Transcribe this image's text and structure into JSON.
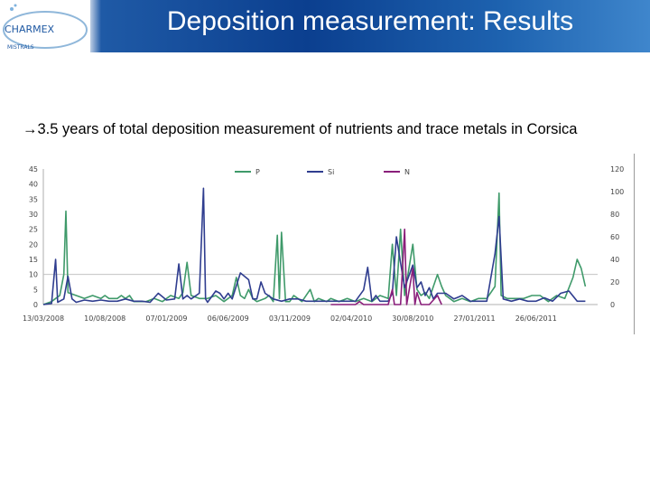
{
  "header": {
    "title": "Deposition measurement: Results",
    "logo_text": "CHARMEX",
    "logo_subtext": "MISTRALS"
  },
  "subtitle": {
    "arrow": "→",
    "text": "3.5 years of total deposition measurement of nutrients and trace metals in Corsica"
  },
  "colors": {
    "P": "#3f9a6a",
    "Si": "#2f3d8f",
    "N": "#8a1f7a",
    "header_blue": "#0b3f8f"
  },
  "chart_data": {
    "type": "line",
    "left_axis": {
      "ylim": [
        0,
        45
      ],
      "ticks": [
        "0",
        "5",
        "10",
        "15",
        "20",
        "25",
        "30",
        "35",
        "40",
        "45"
      ]
    },
    "right_axis": {
      "ylim": [
        0,
        120
      ],
      "ticks": [
        "0",
        "20",
        "40",
        "60",
        "80",
        "100",
        "120"
      ]
    },
    "x_ticks": [
      "13/03/2008",
      "10/08/2008",
      "07/01/2009",
      "06/06/2009",
      "03/11/2009",
      "02/04/2010",
      "30/08/2010",
      "27/01/2011",
      "26/06/2011"
    ],
    "x_range_days": [
      0,
      1350
    ],
    "series": [
      {
        "name": "P",
        "axis": "left",
        "points": [
          [
            0,
            0
          ],
          [
            20,
            1
          ],
          [
            30,
            2
          ],
          [
            40,
            3
          ],
          [
            50,
            10
          ],
          [
            55,
            31
          ],
          [
            60,
            4
          ],
          [
            80,
            3
          ],
          [
            100,
            2
          ],
          [
            120,
            3
          ],
          [
            140,
            2
          ],
          [
            150,
            3
          ],
          [
            160,
            2
          ],
          [
            180,
            2
          ],
          [
            190,
            3
          ],
          [
            200,
            2
          ],
          [
            210,
            3
          ],
          [
            220,
            1
          ],
          [
            250,
            1
          ],
          [
            270,
            2
          ],
          [
            290,
            1
          ],
          [
            310,
            3
          ],
          [
            330,
            2
          ],
          [
            340,
            4
          ],
          [
            350,
            14
          ],
          [
            360,
            3
          ],
          [
            380,
            2
          ],
          [
            400,
            2
          ],
          [
            420,
            3
          ],
          [
            440,
            1
          ],
          [
            450,
            2
          ],
          [
            460,
            3
          ],
          [
            470,
            9
          ],
          [
            480,
            3
          ],
          [
            490,
            2
          ],
          [
            500,
            5
          ],
          [
            510,
            2
          ],
          [
            520,
            1
          ],
          [
            540,
            2
          ],
          [
            550,
            3
          ],
          [
            560,
            1
          ],
          [
            570,
            23
          ],
          [
            575,
            2
          ],
          [
            580,
            24
          ],
          [
            590,
            1
          ],
          [
            600,
            1
          ],
          [
            610,
            3
          ],
          [
            620,
            2
          ],
          [
            630,
            1
          ],
          [
            650,
            5
          ],
          [
            660,
            1
          ],
          [
            670,
            2
          ],
          [
            690,
            1
          ],
          [
            700,
            2
          ],
          [
            720,
            1
          ],
          [
            740,
            2
          ],
          [
            760,
            1
          ],
          [
            780,
            2
          ],
          [
            800,
            1
          ],
          [
            820,
            3
          ],
          [
            840,
            2
          ],
          [
            850,
            20
          ],
          [
            860,
            3
          ],
          [
            870,
            25
          ],
          [
            880,
            3
          ],
          [
            900,
            20
          ],
          [
            910,
            5
          ],
          [
            920,
            3
          ],
          [
            930,
            4
          ],
          [
            940,
            2
          ],
          [
            960,
            10
          ],
          [
            970,
            6
          ],
          [
            980,
            3
          ],
          [
            990,
            2
          ],
          [
            1000,
            1
          ],
          [
            1020,
            2
          ],
          [
            1040,
            1
          ],
          [
            1060,
            2
          ],
          [
            1080,
            2
          ],
          [
            1100,
            6
          ],
          [
            1110,
            37
          ],
          [
            1115,
            3
          ],
          [
            1130,
            2
          ],
          [
            1150,
            2
          ],
          [
            1170,
            2
          ],
          [
            1190,
            3
          ],
          [
            1210,
            3
          ],
          [
            1230,
            1
          ],
          [
            1250,
            3
          ],
          [
            1270,
            2
          ],
          [
            1290,
            9
          ],
          [
            1300,
            15
          ],
          [
            1310,
            12
          ],
          [
            1320,
            6
          ]
        ]
      },
      {
        "name": "Si",
        "axis": "right",
        "points": [
          [
            0,
            0
          ],
          [
            20,
            1
          ],
          [
            30,
            40
          ],
          [
            35,
            2
          ],
          [
            50,
            5
          ],
          [
            60,
            25
          ],
          [
            70,
            5
          ],
          [
            80,
            2
          ],
          [
            100,
            4
          ],
          [
            120,
            3
          ],
          [
            140,
            4
          ],
          [
            160,
            3
          ],
          [
            180,
            3
          ],
          [
            200,
            5
          ],
          [
            220,
            3
          ],
          [
            240,
            3
          ],
          [
            260,
            2
          ],
          [
            280,
            10
          ],
          [
            300,
            4
          ],
          [
            320,
            5
          ],
          [
            330,
            36
          ],
          [
            340,
            5
          ],
          [
            350,
            8
          ],
          [
            360,
            5
          ],
          [
            380,
            10
          ],
          [
            390,
            103
          ],
          [
            395,
            5
          ],
          [
            400,
            2
          ],
          [
            420,
            12
          ],
          [
            430,
            10
          ],
          [
            440,
            5
          ],
          [
            450,
            10
          ],
          [
            460,
            5
          ],
          [
            480,
            28
          ],
          [
            500,
            22
          ],
          [
            510,
            5
          ],
          [
            520,
            5
          ],
          [
            530,
            20
          ],
          [
            540,
            10
          ],
          [
            560,
            5
          ],
          [
            580,
            3
          ],
          [
            600,
            5
          ],
          [
            620,
            5
          ],
          [
            640,
            3
          ],
          [
            660,
            3
          ],
          [
            680,
            3
          ],
          [
            700,
            3
          ],
          [
            720,
            3
          ],
          [
            740,
            3
          ],
          [
            760,
            3
          ],
          [
            780,
            13
          ],
          [
            790,
            33
          ],
          [
            800,
            3
          ],
          [
            810,
            8
          ],
          [
            820,
            3
          ],
          [
            840,
            3
          ],
          [
            850,
            10
          ],
          [
            860,
            60
          ],
          [
            870,
            37
          ],
          [
            880,
            15
          ],
          [
            900,
            35
          ],
          [
            910,
            15
          ],
          [
            920,
            20
          ],
          [
            930,
            8
          ],
          [
            940,
            15
          ],
          [
            950,
            5
          ],
          [
            960,
            10
          ],
          [
            980,
            10
          ],
          [
            1000,
            5
          ],
          [
            1020,
            8
          ],
          [
            1040,
            3
          ],
          [
            1060,
            3
          ],
          [
            1080,
            3
          ],
          [
            1100,
            45
          ],
          [
            1110,
            78
          ],
          [
            1120,
            5
          ],
          [
            1140,
            3
          ],
          [
            1160,
            5
          ],
          [
            1180,
            3
          ],
          [
            1200,
            3
          ],
          [
            1220,
            6
          ],
          [
            1240,
            3
          ],
          [
            1260,
            10
          ],
          [
            1280,
            12
          ],
          [
            1300,
            3
          ],
          [
            1320,
            3
          ]
        ]
      },
      {
        "name": "N",
        "axis": "left",
        "points": [
          [
            700,
            0
          ],
          [
            760,
            0
          ],
          [
            770,
            1
          ],
          [
            780,
            0
          ],
          [
            840,
            0
          ],
          [
            850,
            5
          ],
          [
            855,
            0
          ],
          [
            870,
            0
          ],
          [
            880,
            25
          ],
          [
            885,
            0
          ],
          [
            900,
            12
          ],
          [
            905,
            0
          ],
          [
            910,
            4
          ],
          [
            920,
            0
          ],
          [
            940,
            0
          ],
          [
            960,
            3
          ],
          [
            970,
            0
          ]
        ]
      }
    ],
    "grid": false,
    "legend": "top-center"
  }
}
